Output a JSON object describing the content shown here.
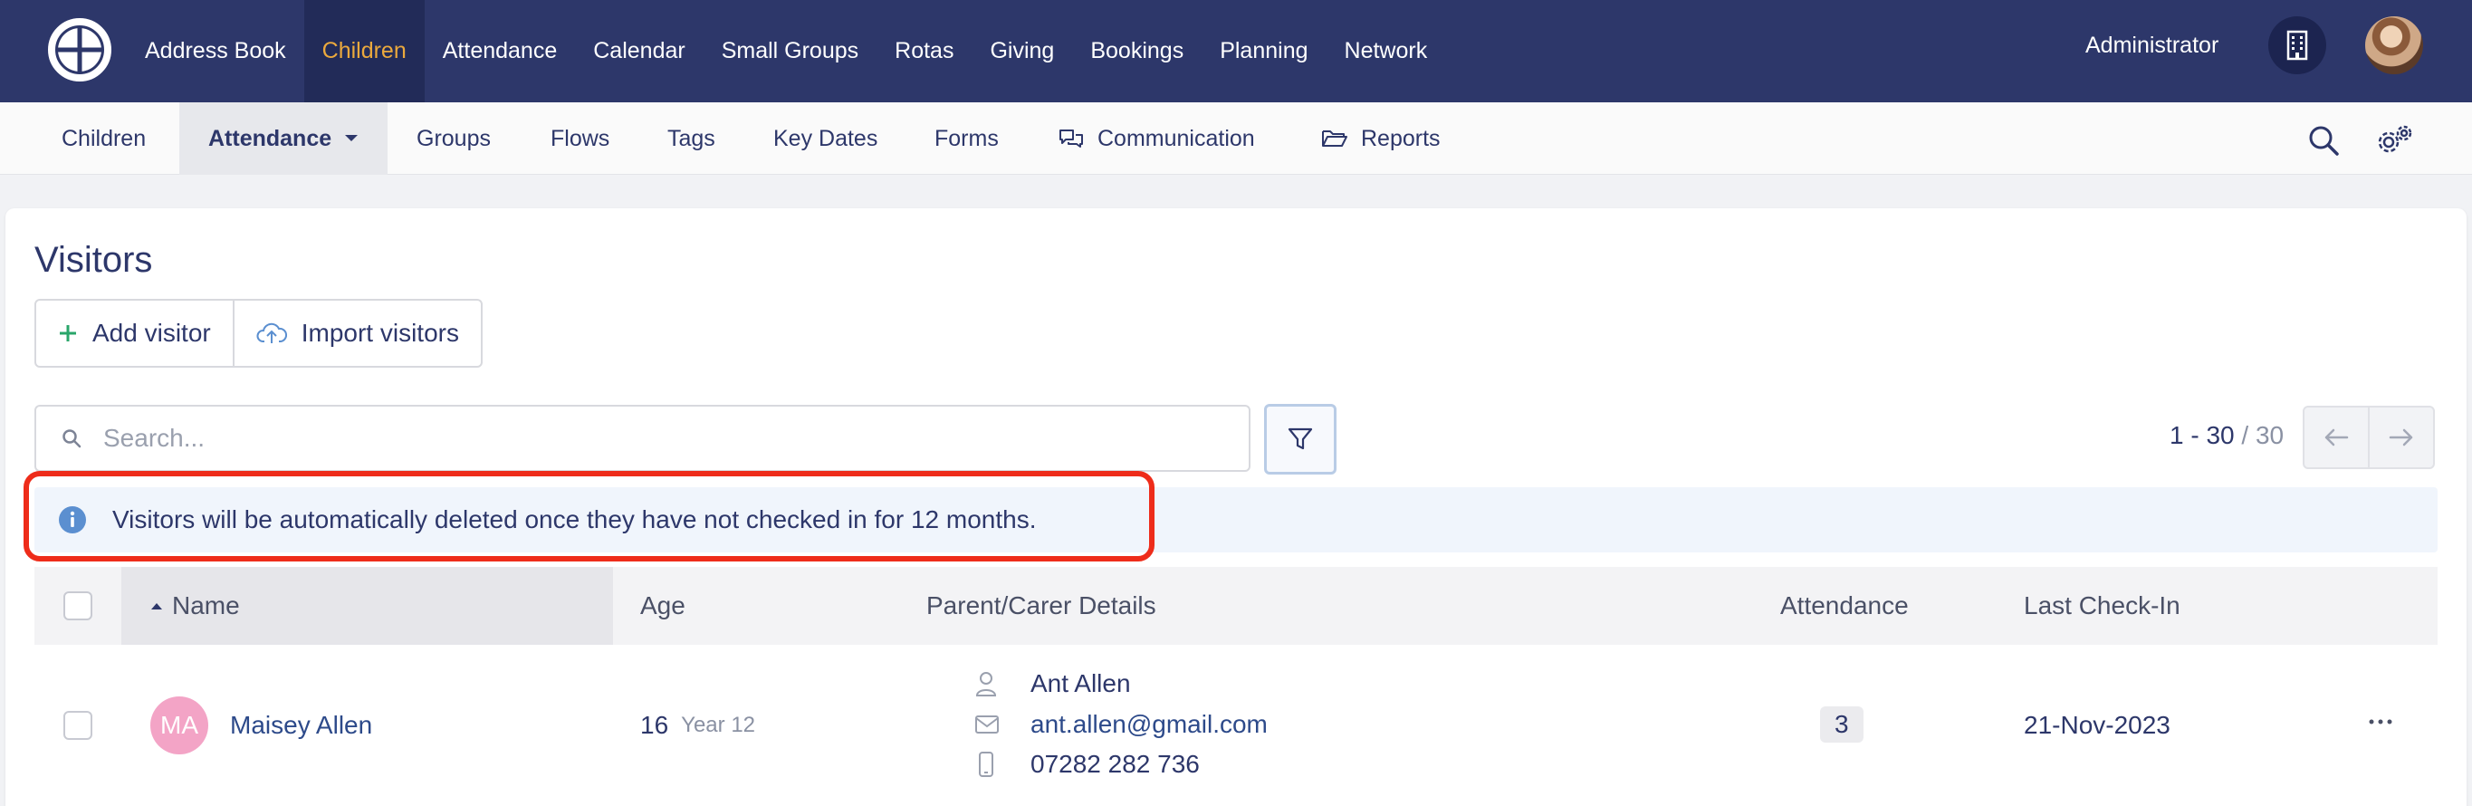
{
  "topnav": {
    "items": [
      "Address Book",
      "Children",
      "Attendance",
      "Calendar",
      "Small Groups",
      "Rotas",
      "Giving",
      "Bookings",
      "Planning",
      "Network"
    ],
    "active_index": 1,
    "user_label": "Administrator"
  },
  "subnav": {
    "items": [
      "Children",
      "Attendance",
      "Groups",
      "Flows",
      "Tags",
      "Key Dates",
      "Forms",
      "Communication",
      "Reports"
    ],
    "active_index": 1
  },
  "page": {
    "title": "Visitors",
    "add_visitor": "Add visitor",
    "import_visitors": "Import visitors",
    "search_placeholder": "Search...",
    "pagination": {
      "range": "1 - 30",
      "total": " / 30"
    },
    "notice": "Visitors will be automatically deleted once they have not checked in for 12 months."
  },
  "table": {
    "columns": [
      "Name",
      "Age",
      "Parent/Carer Details",
      "Attendance",
      "Last Check-In"
    ],
    "sort_column": "Name",
    "sort_direction": "ascending",
    "rows": [
      {
        "initials": "MA",
        "name": "Maisey Allen",
        "age": "16",
        "year": "Year 12",
        "parent_name": "Ant Allen",
        "parent_email": "ant.allen@gmail.com",
        "parent_phone": "07282 282 736",
        "attendance": "3",
        "last_checkin": "21-Nov-2023"
      }
    ]
  },
  "colors": {
    "nav_bg": "#2d376a",
    "active_nav_text": "#eba93d",
    "highlight_border": "#ee2c1a",
    "avatar_bg": "#f3a4c6",
    "notice_bg": "#f0f5fc"
  },
  "icons": {
    "logo": "wheel-logo-icon",
    "building": "building-icon",
    "search": "search-icon",
    "settings": "gear-icon",
    "communication": "chat-bubbles-icon",
    "reports": "folder-open-icon",
    "add": "plus-icon",
    "import": "cloud-upload-icon",
    "filter": "filter-icon",
    "info": "info-icon",
    "person": "person-icon",
    "email": "envelope-icon",
    "phone": "phone-icon",
    "more": "more-horizontal-icon"
  }
}
